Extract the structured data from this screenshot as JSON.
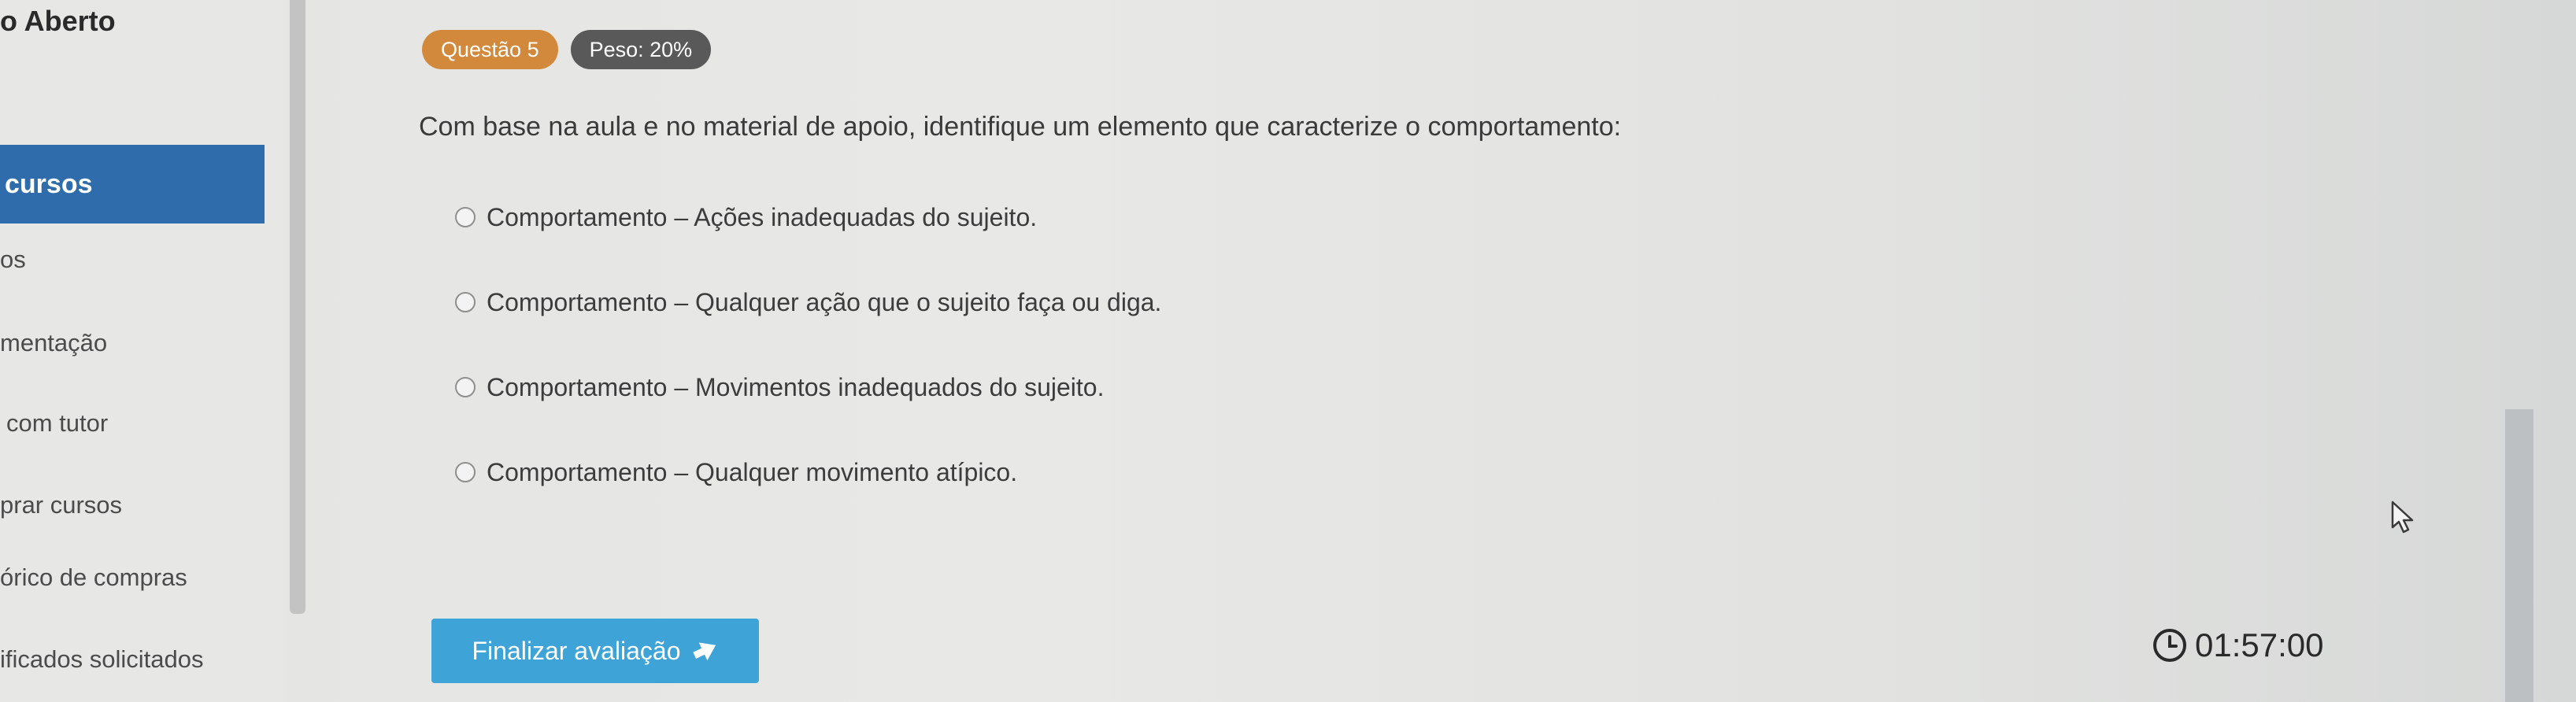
{
  "sidebar": {
    "title": "o Aberto",
    "items": [
      {
        "label": "cursos",
        "active": true
      },
      {
        "label": "os"
      },
      {
        "label": "mentação"
      },
      {
        "label": "com tutor"
      },
      {
        "label": "prar cursos"
      },
      {
        "label": "órico de compras"
      },
      {
        "label": "ificados solicitados"
      }
    ]
  },
  "question": {
    "number_badge": "Questão 5",
    "weight_badge": "Peso: 20%",
    "text": "Com base na aula e no material de apoio, identifique um elemento que caracterize o comportamento:",
    "options": [
      {
        "label": "Comportamento – Ações inadequadas do sujeito."
      },
      {
        "label": "Comportamento – Qualquer ação que o sujeito faça ou diga."
      },
      {
        "label": "Comportamento – Movimentos inadequados do sujeito."
      },
      {
        "label": "Comportamento – Qualquer movimento atípico."
      }
    ]
  },
  "actions": {
    "finish_label": "Finalizar avaliação"
  },
  "timer": {
    "value": "01:57:00"
  },
  "icons": {
    "finish": "arrow-icon",
    "timer": "clock-icon",
    "cursor": "mouse-cursor-icon"
  },
  "colors": {
    "sidebar_active": "#2f6cab",
    "question_badge": "#d2893b",
    "weight_badge": "#595959",
    "finish_button": "#3ea3d6"
  }
}
